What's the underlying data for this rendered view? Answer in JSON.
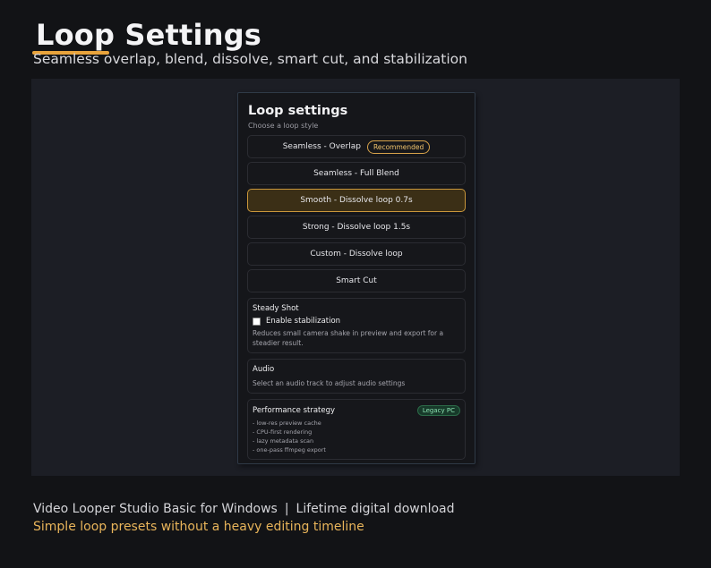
{
  "hero": {
    "title": "Loop Settings",
    "subtitle": "Seamless overlap, blend, dissolve, smart cut, and stabilization"
  },
  "panel": {
    "title": "Loop settings",
    "hint": "Choose a loop style",
    "options": [
      {
        "label": "Seamless - Overlap",
        "badge": "Recommended",
        "selected": false
      },
      {
        "label": "Seamless - Full Blend",
        "selected": false
      },
      {
        "label": "Smooth - Dissolve loop 0.7s",
        "selected": true
      },
      {
        "label": "Strong - Dissolve loop 1.5s",
        "selected": false
      },
      {
        "label": "Custom - Dissolve loop",
        "selected": false
      },
      {
        "label": "Smart Cut",
        "selected": false
      }
    ],
    "steady": {
      "title": "Steady Shot",
      "checkbox_label": "Enable stabilization",
      "checked": false,
      "description": "Reduces small camera shake in preview and export for a steadier result."
    },
    "audio": {
      "title": "Audio",
      "description": "Select an audio track to adjust audio settings"
    },
    "performance": {
      "title": "Performance strategy",
      "badge": "Legacy PC",
      "items": [
        "- low-res preview cache",
        "- CPU-first rendering",
        "- lazy metadata scan",
        "- one-pass ffmpeg export"
      ]
    }
  },
  "footer": {
    "product": "Video Looper Studio Basic for Windows",
    "separator": "|",
    "license": "Lifetime digital download",
    "tagline": "Simple loop presets without a heavy editing timeline"
  },
  "colors": {
    "accent": "#e8a33c",
    "selected_bg": "#3b2f16",
    "legacy_badge": "#8be0b0"
  }
}
